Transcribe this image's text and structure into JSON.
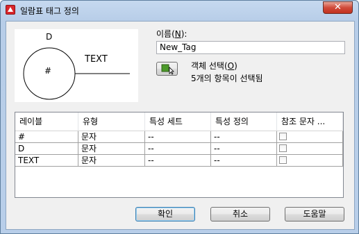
{
  "window": {
    "title": "일람표 태그 정의",
    "close_glyph": "✕"
  },
  "preview": {
    "top_label": "D",
    "text_label": "TEXT",
    "center_label": "#"
  },
  "name": {
    "label_prefix": "이름(",
    "hotkey": "N",
    "label_suffix": "):",
    "value": "New_Tag"
  },
  "select": {
    "label_prefix": "객체 선택(",
    "hotkey": "O",
    "label_suffix": ")",
    "status": "5개의 항목이 선택됨",
    "icon": "select-objects-icon"
  },
  "grid": {
    "columns": [
      "레이블",
      "유형",
      "특성 세트",
      "특성 정의",
      "참조 문자 ..."
    ],
    "rows": [
      {
        "label": "#",
        "type": "문자",
        "set": "--",
        "def": "--",
        "ref": false
      },
      {
        "label": "D",
        "type": "문자",
        "set": "--",
        "def": "--",
        "ref": false
      },
      {
        "label": "TEXT",
        "type": "문자",
        "set": "--",
        "def": "--",
        "ref": false
      }
    ]
  },
  "buttons": {
    "ok": "확인",
    "cancel": "취소",
    "help": "도움말"
  }
}
